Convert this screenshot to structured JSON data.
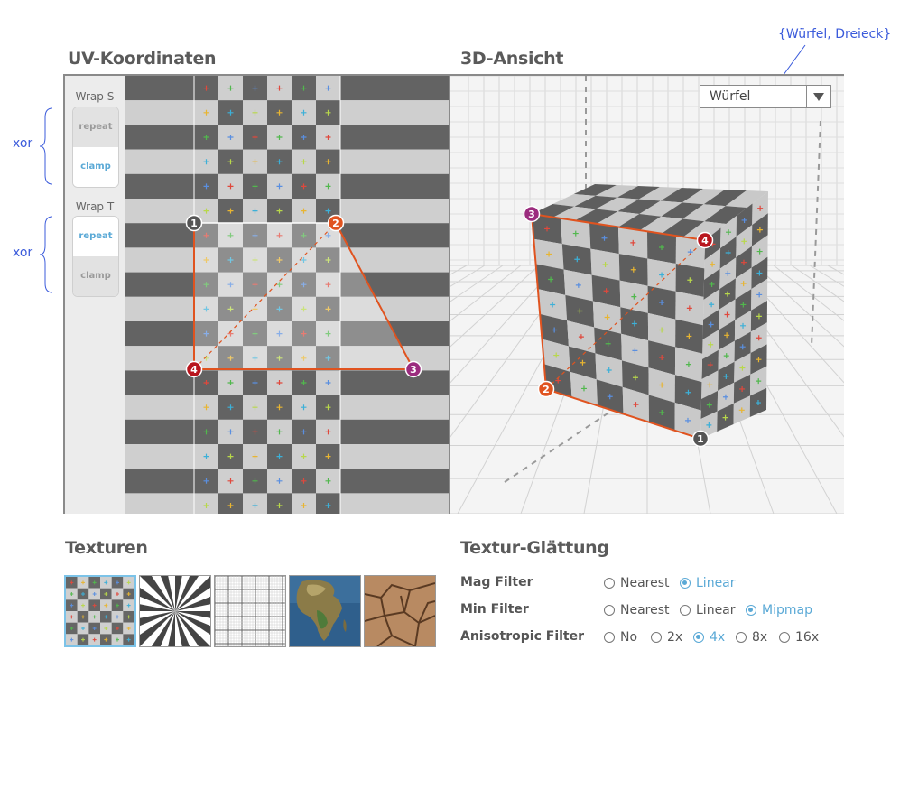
{
  "annotations": {
    "geometry_options": "{Würfel, Dreieck}",
    "xor_s": "xor",
    "xor_t": "xor"
  },
  "uv_panel": {
    "title": "UV-Koordinaten",
    "wrap_s": {
      "label": "Wrap S",
      "options": [
        "repeat",
        "clamp"
      ],
      "selected": "clamp"
    },
    "wrap_t": {
      "label": "Wrap T",
      "options": [
        "repeat",
        "clamp"
      ],
      "selected": "repeat"
    },
    "vertices": [
      "1",
      "2",
      "3",
      "4"
    ]
  },
  "view_panel": {
    "title": "3D-Ansicht",
    "geometry_select": {
      "value": "Würfel"
    },
    "vertices": [
      "1",
      "2",
      "3",
      "4"
    ]
  },
  "textures": {
    "title": "Texturen",
    "items": [
      {
        "icon": "checkerboard-texture",
        "selected": true
      },
      {
        "icon": "starburst-texture",
        "selected": false
      },
      {
        "icon": "grid-texture",
        "selected": false
      },
      {
        "icon": "earth-texture",
        "selected": false
      },
      {
        "icon": "cracked-earth-texture",
        "selected": false
      }
    ]
  },
  "filtering": {
    "title": "Textur-Glättung",
    "mag": {
      "label": "Mag Filter",
      "options": [
        "Nearest",
        "Linear"
      ],
      "selected": "Linear"
    },
    "min": {
      "label": "Min Filter",
      "options": [
        "Nearest",
        "Linear",
        "Mipmap"
      ],
      "selected": "Mipmap"
    },
    "aniso": {
      "label": "Anisotropic Filter",
      "options": [
        "No",
        "2x",
        "4x",
        "8x",
        "16x"
      ],
      "selected": "4x"
    }
  },
  "colors": {
    "accent": "#5aa9d6",
    "annotation": "#3b5bdb",
    "edge_orange": "#e0531f",
    "vertex_dark": "#555555",
    "vertex_orange": "#e0531f",
    "vertex_purple": "#9b2c7e",
    "vertex_red": "#b8151d"
  }
}
